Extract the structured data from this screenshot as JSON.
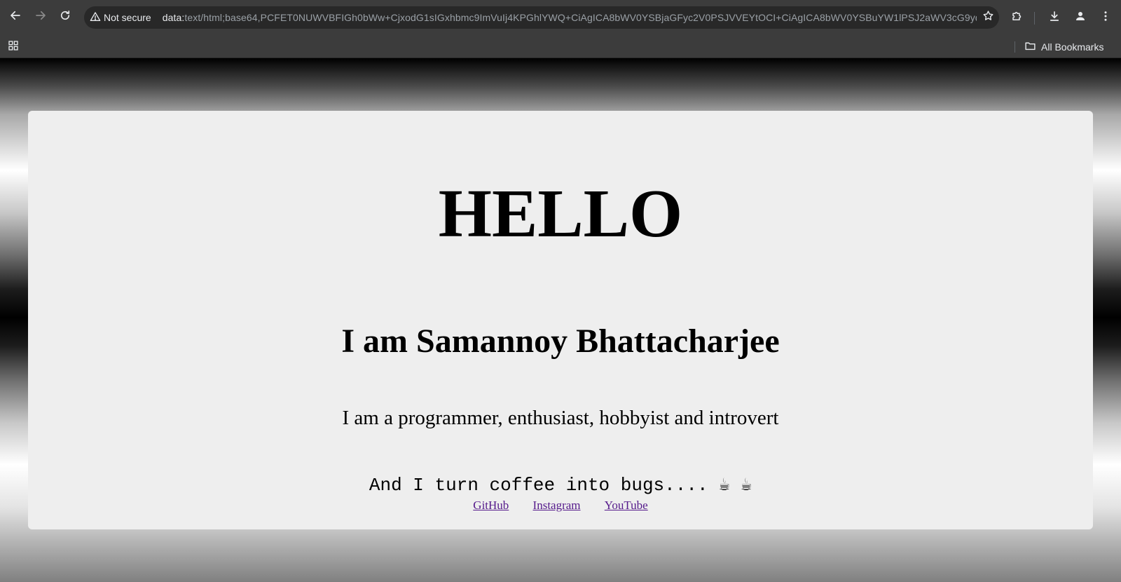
{
  "browser": {
    "security_label": "Not secure",
    "url_scheme": "data:",
    "url_rest": "text/html;base64,PCFET0NUWVBFIGh0bWw+CjxodG1sIGxhbmc9ImVuIj4KPGhlYWQ+CiAgICA8bWV0YSBjaGFyc2V0PSJVVEYtOCI+CiAgICA8bWV0YSBuYW1lPSJ2aWV3cG9ydC...",
    "bookmarks_label": "All Bookmarks",
    "icons": {
      "back": "arrow-left-icon",
      "forward": "arrow-right-icon",
      "reload": "reload-icon",
      "warning": "warning-triangle-icon",
      "star": "star-icon",
      "extensions": "puzzle-icon",
      "download": "download-icon",
      "profile": "person-icon",
      "menu": "kebab-menu-icon",
      "apps": "apps-grid-icon",
      "folder": "folder-icon"
    }
  },
  "page": {
    "hello": "HELLO",
    "intro": "I am Samannoy Bhattacharjee",
    "description": "I am a programmer, enthusiast, hobbyist and introvert",
    "coffee": "And I turn coffee into bugs.... ☕ ☕",
    "links": {
      "github": "GitHub",
      "instagram": "Instagram",
      "youtube": "YouTube"
    }
  },
  "colors": {
    "chrome_bg": "#3c3c3c",
    "omnibox_bg": "#282828",
    "card_bg": "#eeeeee",
    "link_visited": "#551a8b"
  }
}
